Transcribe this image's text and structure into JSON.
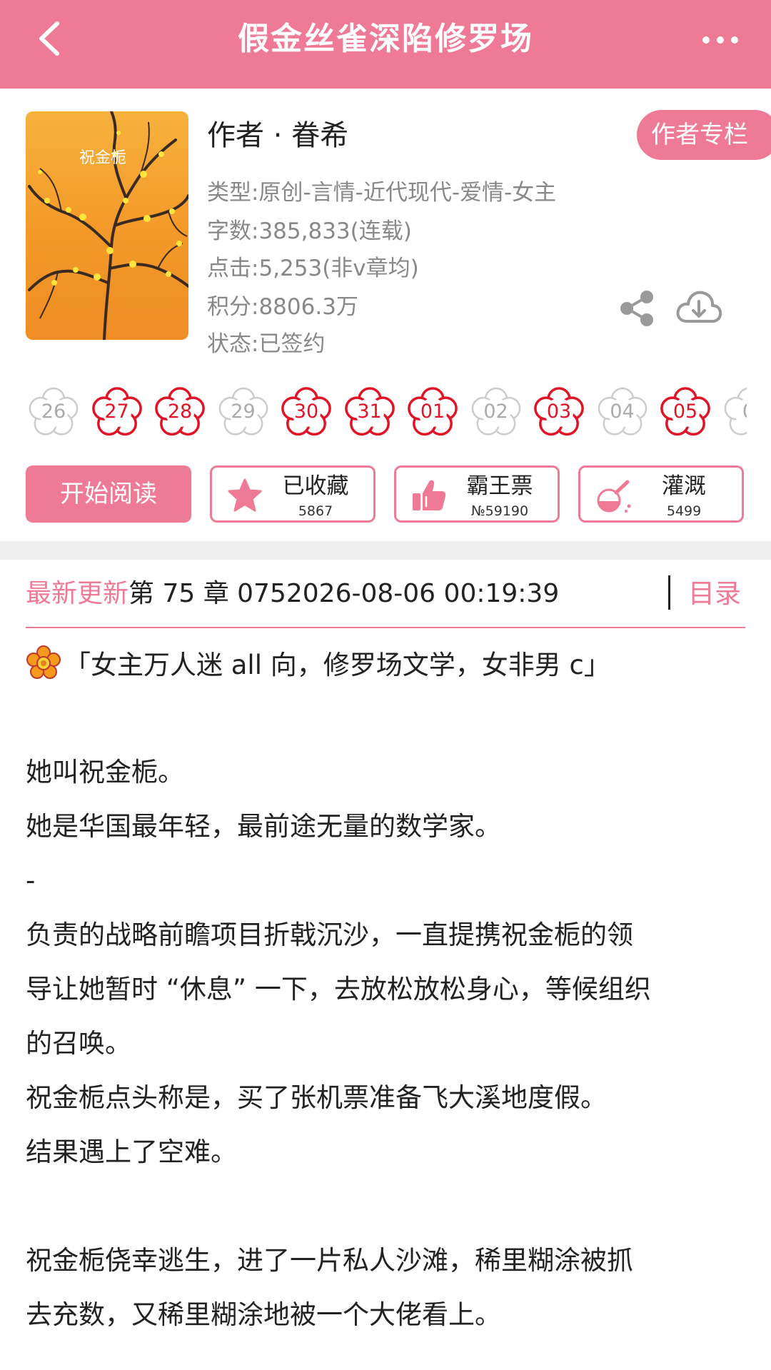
{
  "header": {
    "title": "假金丝雀深陷修罗场",
    "back_icon": "chevron-left-icon",
    "more_icon": "more-dots-icon",
    "bg_color": "#ef7a96"
  },
  "book": {
    "cover_icon": "book-cover-image",
    "cover_title": "祝金栀",
    "author_line": "作者 · 眷希",
    "author_column_label": "作者专栏",
    "meta": [
      "类型:原创-言情-近代现代-爱情-女主",
      "字数:385,833(连载)",
      "点击:5,253(非v章均)",
      "积分:8806.3万",
      "状态:已签约"
    ]
  },
  "flowers": [
    {
      "num": "26",
      "active": false
    },
    {
      "num": "27",
      "active": true
    },
    {
      "num": "28",
      "active": true
    },
    {
      "num": "29",
      "active": false
    },
    {
      "num": "30",
      "active": true
    },
    {
      "num": "31",
      "active": true
    },
    {
      "num": "01",
      "active": true
    },
    {
      "num": "02",
      "active": false
    },
    {
      "num": "03",
      "active": true
    },
    {
      "num": "04",
      "active": false
    },
    {
      "num": "05",
      "active": true
    },
    {
      "num": "0",
      "active": false
    }
  ],
  "actions": {
    "read_label": "开始阅读",
    "collect": {
      "label": "已收藏",
      "count": "5867",
      "icon": "star-icon"
    },
    "vote": {
      "label": "霸王票",
      "count": "№59190",
      "icon": "thumbs-up-icon"
    },
    "water": {
      "label": "灌溉",
      "count": "5499",
      "icon": "watering-flask-icon"
    }
  },
  "update": {
    "prefix": "最新更新",
    "chapter": "第 75 章 075",
    "time": "2026-08-06 00:19:39",
    "toc_label": "目录"
  },
  "synopsis": {
    "tagline": "「女主万人迷 all 向，修罗场文学，女非男 c」",
    "lines": [
      "她叫祝金栀。",
      "她是华国最年轻，最前途无量的数学家。",
      "-",
      "负责的战略前瞻项目折戟沉沙，一直提携祝金栀的领",
      "导让她暂时 “休息” 一下，去放松放松身心，等候组织",
      "的召唤。",
      "祝金栀点头称是，买了张机票准备飞大溪地度假。",
      "结果遇上了空难。",
      "祝金栀侥幸逃生，进了一片私人沙滩，稀里糊涂被抓",
      "去充数，又稀里糊涂地被一个大佬看上。"
    ]
  },
  "colors": {
    "accent": "#ef7a96",
    "flower_active": "#e01426",
    "flower_inactive": "#cccccc"
  }
}
